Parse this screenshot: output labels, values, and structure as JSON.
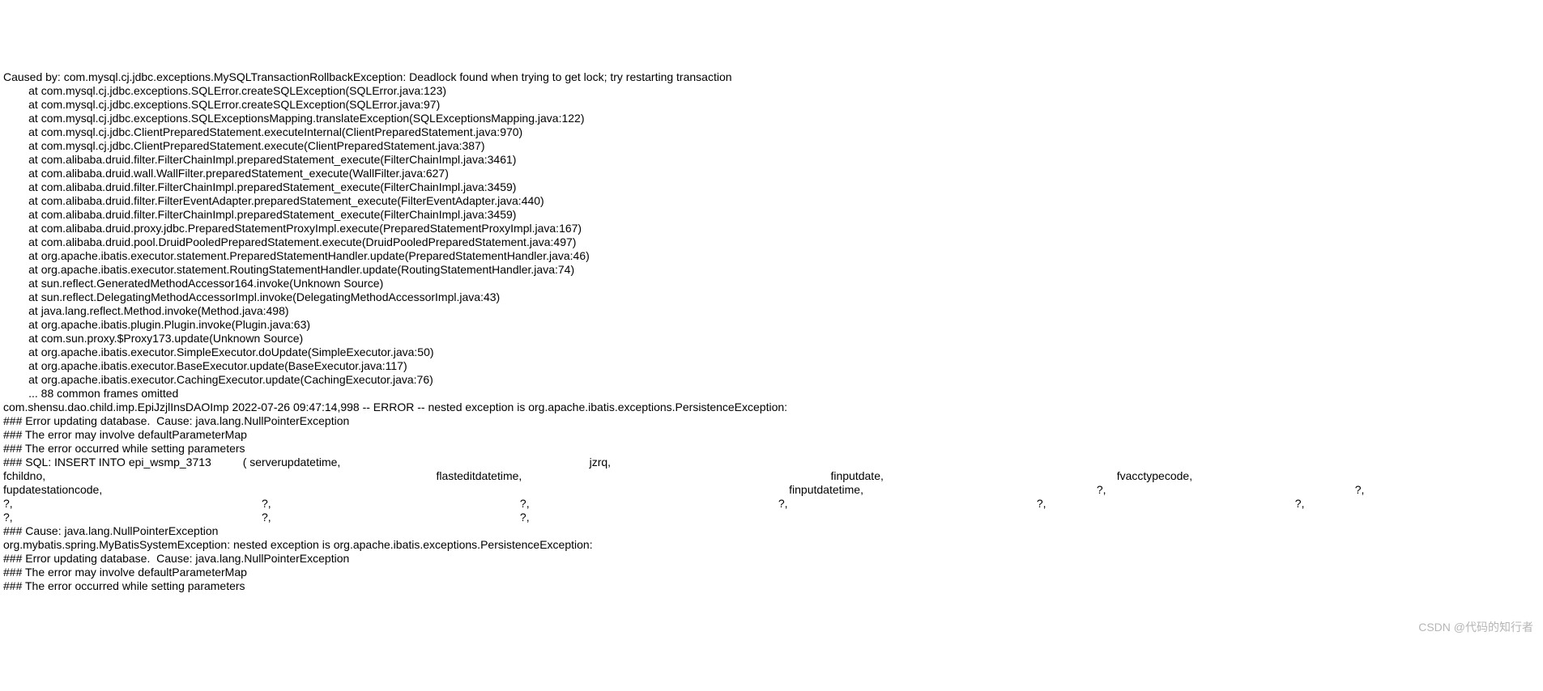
{
  "stacktrace": {
    "caused_by": "Caused by: com.mysql.cj.jdbc.exceptions.MySQLTransactionRollbackException: Deadlock found when trying to get lock; try restarting transaction",
    "frames": [
      "        at com.mysql.cj.jdbc.exceptions.SQLError.createSQLException(SQLError.java:123)",
      "        at com.mysql.cj.jdbc.exceptions.SQLError.createSQLException(SQLError.java:97)",
      "        at com.mysql.cj.jdbc.exceptions.SQLExceptionsMapping.translateException(SQLExceptionsMapping.java:122)",
      "        at com.mysql.cj.jdbc.ClientPreparedStatement.executeInternal(ClientPreparedStatement.java:970)",
      "        at com.mysql.cj.jdbc.ClientPreparedStatement.execute(ClientPreparedStatement.java:387)",
      "        at com.alibaba.druid.filter.FilterChainImpl.preparedStatement_execute(FilterChainImpl.java:3461)",
      "        at com.alibaba.druid.wall.WallFilter.preparedStatement_execute(WallFilter.java:627)",
      "        at com.alibaba.druid.filter.FilterChainImpl.preparedStatement_execute(FilterChainImpl.java:3459)",
      "        at com.alibaba.druid.filter.FilterEventAdapter.preparedStatement_execute(FilterEventAdapter.java:440)",
      "        at com.alibaba.druid.filter.FilterChainImpl.preparedStatement_execute(FilterChainImpl.java:3459)",
      "        at com.alibaba.druid.proxy.jdbc.PreparedStatementProxyImpl.execute(PreparedStatementProxyImpl.java:167)",
      "        at com.alibaba.druid.pool.DruidPooledPreparedStatement.execute(DruidPooledPreparedStatement.java:497)",
      "        at org.apache.ibatis.executor.statement.PreparedStatementHandler.update(PreparedStatementHandler.java:46)",
      "        at org.apache.ibatis.executor.statement.RoutingStatementHandler.update(RoutingStatementHandler.java:74)",
      "        at sun.reflect.GeneratedMethodAccessor164.invoke(Unknown Source)",
      "        at sun.reflect.DelegatingMethodAccessorImpl.invoke(DelegatingMethodAccessorImpl.java:43)",
      "        at java.lang.reflect.Method.invoke(Method.java:498)",
      "        at org.apache.ibatis.plugin.Plugin.invoke(Plugin.java:63)",
      "        at com.sun.proxy.$Proxy173.update(Unknown Source)",
      "        at org.apache.ibatis.executor.SimpleExecutor.doUpdate(SimpleExecutor.java:50)",
      "        at org.apache.ibatis.executor.BaseExecutor.update(BaseExecutor.java:117)",
      "        at org.apache.ibatis.executor.CachingExecutor.update(CachingExecutor.java:76)",
      "        ... 88 common frames omitted"
    ],
    "logline": "com.shensu.dao.child.imp.EpiJzjlInsDAOImp 2022-07-26 09:47:14,998 -- ERROR -- nested exception is org.apache.ibatis.exceptions.PersistenceException:",
    "err1": "### Error updating database.  Cause: java.lang.NullPointerException",
    "err2": "### The error may involve defaultParameterMap",
    "err3": "### The error occurred while setting parameters",
    "sql": "### SQL: INSERT INTO epi_wsmp_3713          ( serverupdatetime,                                                                               jzrq,                                                                                                                                                                                                                                                                                              fchildno,                                                                                                                            flasteditdatetime,                                                                                                  finputdate,                                                                          fvacctypecode,                                                                                          fupdatestationcode,                                                                                                                                                                                                                          finputdatetime,                                                                          ?,                                                                               ?,                                                                               ?,                                                                               ?,                                                                               ?,                                                                               ?,                                                                               ?,                                                                               ?,                                                                               ?,                                                                               ?,                                                                               ?,",
    "cause": "### Cause: java.lang.NullPointerException",
    "mybatis": "org.mybatis.spring.MyBatisSystemException: nested exception is org.apache.ibatis.exceptions.PersistenceException:",
    "err1b": "### Error updating database.  Cause: java.lang.NullPointerException",
    "err2b": "### The error may involve defaultParameterMap",
    "err3b": "### The error occurred while setting parameters"
  },
  "watermark": "CSDN @代码的知行者"
}
